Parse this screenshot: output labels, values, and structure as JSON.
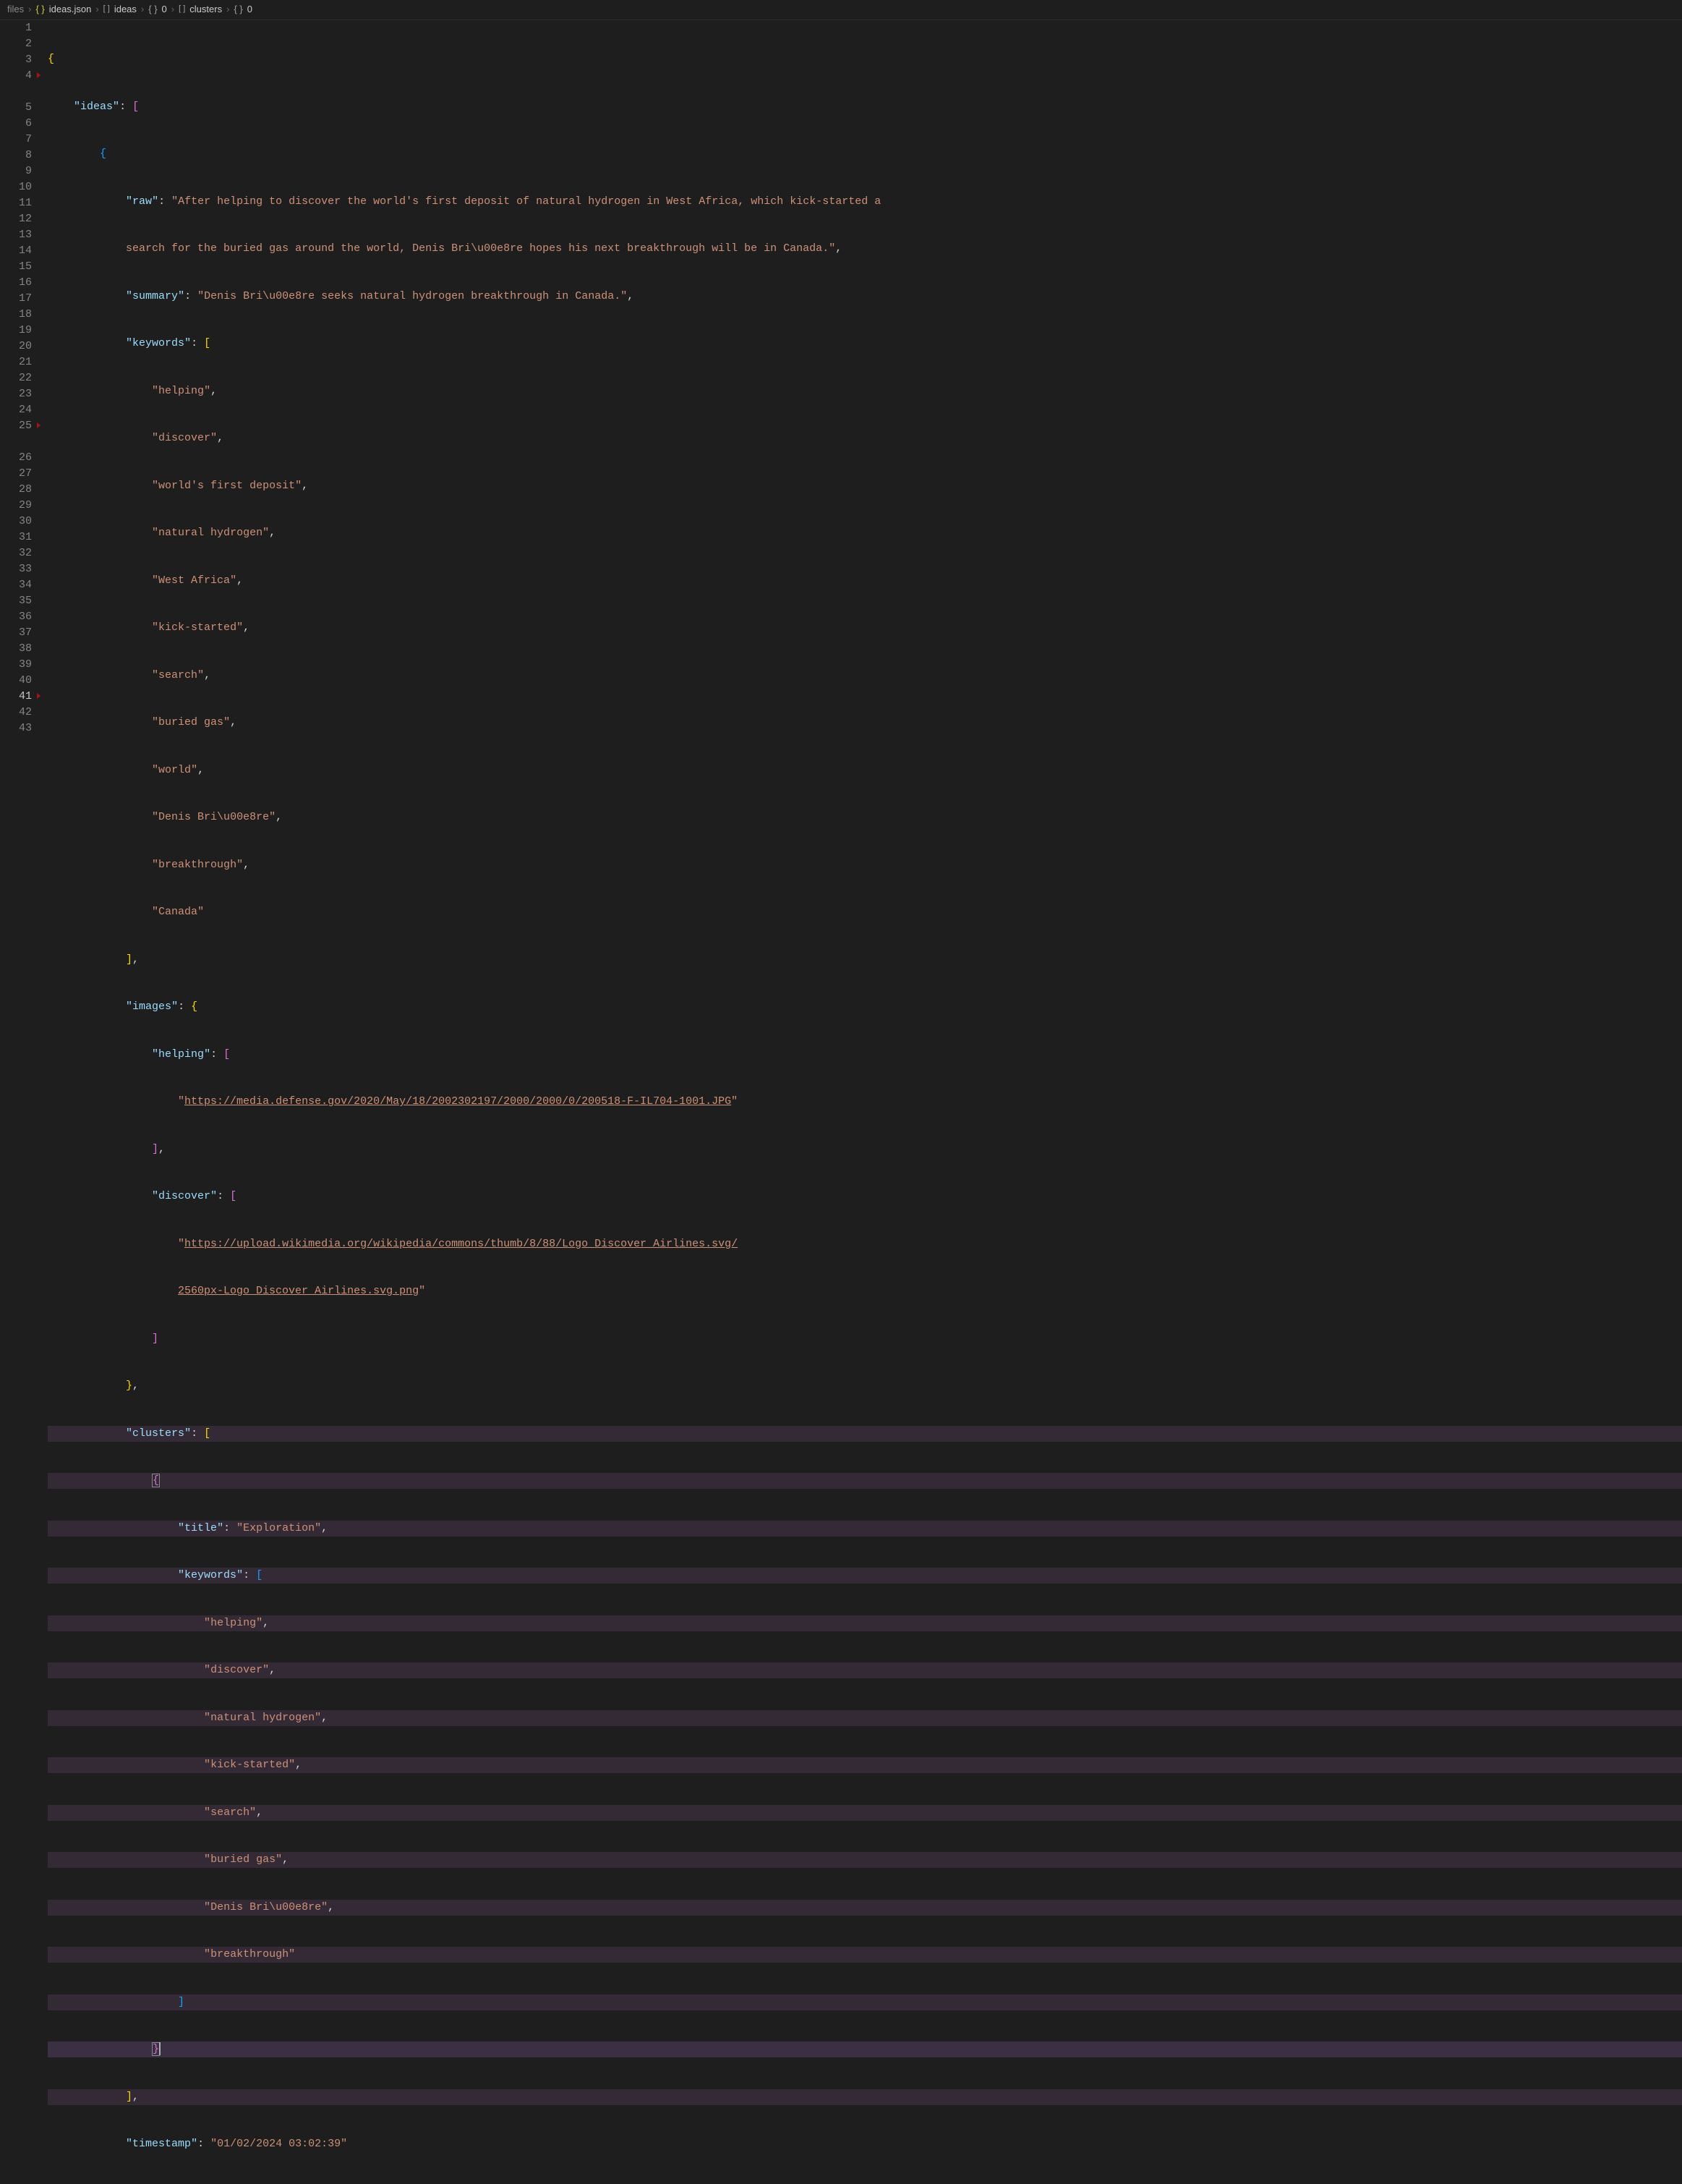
{
  "breadcrumb": {
    "root": "files",
    "file": "ideas.json",
    "path": [
      "ideas",
      "0",
      "clusters",
      "0"
    ],
    "icons": {
      "file": "{ }",
      "array": "[ ]",
      "object": "{ }"
    }
  },
  "editor": {
    "active_line": 41,
    "lines": {
      "l1": "{",
      "l2": "    \"ideas\": [",
      "l3": "        {",
      "l4a": "            \"raw\": \"After helping to discover the world's first deposit of natural hydrogen in West Africa, which kick-started a",
      "l4b": "            search for the buried gas around the world, Denis Bri\\u00e8re hopes his next breakthrough will be in Canada.\",",
      "l5": "            \"summary\": \"Denis Bri\\u00e8re seeks natural hydrogen breakthrough in Canada.\",",
      "l6": "            \"keywords\": [",
      "l7": "                \"helping\",",
      "l8": "                \"discover\",",
      "l9": "                \"world's first deposit\",",
      "l10": "                \"natural hydrogen\",",
      "l11": "                \"West Africa\",",
      "l12": "                \"kick-started\",",
      "l13": "                \"search\",",
      "l14": "                \"buried gas\",",
      "l15": "                \"world\",",
      "l16": "                \"Denis Bri\\u00e8re\",",
      "l17": "                \"breakthrough\",",
      "l18": "                \"Canada\"",
      "l19": "            ],",
      "l20": "            \"images\": {",
      "l21": "                \"helping\": [",
      "l22": "                    \"https://media.defense.gov/2020/May/18/2002302197/2000/2000/0/200518-F-IL704-1001.JPG\"",
      "l23": "                ],",
      "l24": "                \"discover\": [",
      "l25a": "                    \"https://upload.wikimedia.org/wikipedia/commons/thumb/8/88/Logo_Discover_Airlines.svg/",
      "l25b": "                    2560px-Logo_Discover_Airlines.svg.png\"",
      "l26": "                ]",
      "l27": "            },",
      "l28": "            \"clusters\": [",
      "l29": "                {",
      "l30": "                    \"title\": \"Exploration\",",
      "l31": "                    \"keywords\": [",
      "l32": "                        \"helping\",",
      "l33": "                        \"discover\",",
      "l34": "                        \"natural hydrogen\",",
      "l35": "                        \"kick-started\",",
      "l36": "                        \"search\",",
      "l37": "                        \"buried gas\",",
      "l38": "                        \"Denis Bri\\u00e8re\",",
      "l39": "                        \"breakthrough\"",
      "l40": "                    ]",
      "l41": "                }",
      "l42": "            ],",
      "l43": "            \"timestamp\": \"01/02/2024 03:02:39\""
    }
  },
  "json_content": {
    "ideas_key": "ideas",
    "raw_key": "raw",
    "raw_value": "After helping to discover the world's first deposit of natural hydrogen in West Africa, which kick-started a search for the buried gas around the world, Denis Bri\\u00e8re hopes his next breakthrough will be in Canada.",
    "summary_key": "summary",
    "summary_value": "Denis Bri\\u00e8re seeks natural hydrogen breakthrough in Canada.",
    "keywords_key": "keywords",
    "keywords": [
      "helping",
      "discover",
      "world's first deposit",
      "natural hydrogen",
      "West Africa",
      "kick-started",
      "search",
      "buried gas",
      "world",
      "Denis Bri\\u00e8re",
      "breakthrough",
      "Canada"
    ],
    "images_key": "images",
    "images": {
      "helping_key": "helping",
      "helping_urls": [
        "https://media.defense.gov/2020/May/18/2002302197/2000/2000/0/200518-F-IL704-1001.JPG"
      ],
      "discover_key": "discover",
      "discover_urls": [
        "https://upload.wikimedia.org/wikipedia/commons/thumb/8/88/Logo_Discover_Airlines.svg/2560px-Logo_Discover_Airlines.svg.png"
      ]
    },
    "clusters_key": "clusters",
    "clusters": [
      {
        "title_key": "title",
        "title": "Exploration",
        "keywords_key": "keywords",
        "keywords": [
          "helping",
          "discover",
          "natural hydrogen",
          "kick-started",
          "search",
          "buried gas",
          "Denis Bri\\u00e8re",
          "breakthrough"
        ]
      }
    ],
    "timestamp_key": "timestamp",
    "timestamp_value": "01/02/2024 03:02:39"
  },
  "line_numbers": [
    "1",
    "2",
    "3",
    "4",
    "5",
    "6",
    "7",
    "8",
    "9",
    "10",
    "11",
    "12",
    "13",
    "14",
    "15",
    "16",
    "17",
    "18",
    "19",
    "20",
    "21",
    "22",
    "23",
    "24",
    "25",
    "26",
    "27",
    "28",
    "29",
    "30",
    "31",
    "32",
    "33",
    "34",
    "35",
    "36",
    "37",
    "38",
    "39",
    "40",
    "41",
    "42",
    "43"
  ],
  "markers_at": [
    4,
    25,
    41
  ]
}
